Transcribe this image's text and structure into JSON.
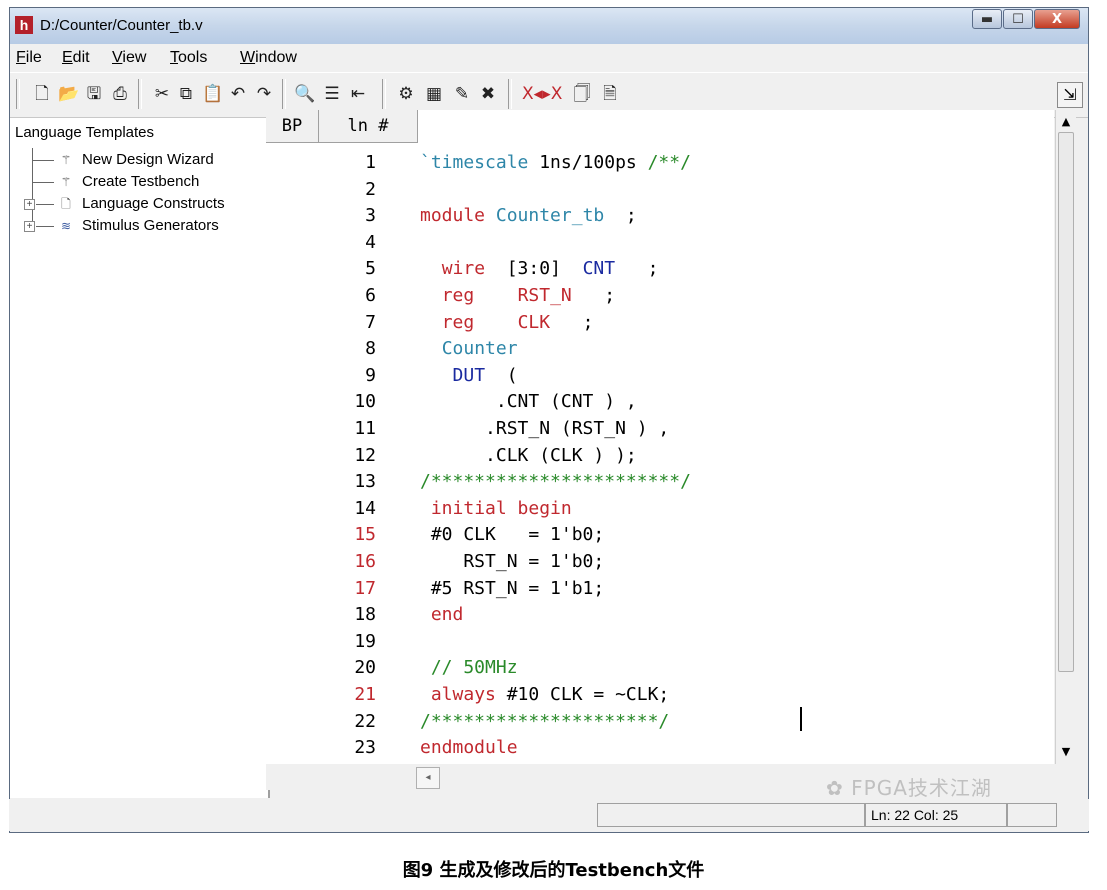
{
  "window": {
    "title": "D:/Counter/Counter_tb.v",
    "app_icon": "h",
    "controls": {
      "minimize": "▬",
      "maximize": "☐",
      "close": "X"
    }
  },
  "menu": [
    "File",
    "Edit",
    "View",
    "Tools",
    "Window"
  ],
  "toolbar_icons": [
    "new-file-icon",
    "open-folder-icon",
    "save-icon",
    "print-icon",
    "cut-icon",
    "copy-icon",
    "paste-icon",
    "undo-icon",
    "redo-icon",
    "find-icon",
    "indent-icon",
    "outdent-icon",
    "compile-icon",
    "simulate-icon",
    "wave-icon",
    "clear-icon",
    "comment-icon",
    "doc-icon",
    "doc2-icon",
    "dock-icon"
  ],
  "left_panel": {
    "title": "Language Templates",
    "items": [
      {
        "label": "New Design Wizard",
        "icon": "wizard-icon"
      },
      {
        "label": "Create Testbench",
        "icon": "wizard-icon"
      },
      {
        "label": "Language Constructs",
        "icon": "doc-icon"
      },
      {
        "label": "Stimulus Generators",
        "icon": "generator-icon"
      }
    ]
  },
  "editor": {
    "header_bp": "BP",
    "header_ln": "ln #",
    "lines": [
      {
        "n": "1",
        "text": "`timescale 1ns/100ps /**/"
      },
      {
        "n": "2",
        "text": ""
      },
      {
        "n": "3",
        "text": "module Counter_tb  ;"
      },
      {
        "n": "4",
        "text": ""
      },
      {
        "n": "5",
        "text": "  wire  [3:0]  CNT   ;"
      },
      {
        "n": "6",
        "text": "  reg    RST_N   ;"
      },
      {
        "n": "7",
        "text": "  reg    CLK   ;"
      },
      {
        "n": "8",
        "text": "  Counter"
      },
      {
        "n": "9",
        "text": "   DUT  ("
      },
      {
        "n": "10",
        "text": "       .CNT (CNT ) ,"
      },
      {
        "n": "11",
        "text": "      .RST_N (RST_N ) ,"
      },
      {
        "n": "12",
        "text": "      .CLK (CLK ) );"
      },
      {
        "n": "13",
        "text": "/***********************/"
      },
      {
        "n": "14",
        "text": " initial begin"
      },
      {
        "n": "15",
        "text": " #0 CLK   = 1'b0;"
      },
      {
        "n": "16",
        "text": "    RST_N = 1'b0;"
      },
      {
        "n": "17",
        "text": " #5 RST_N = 1'b1;"
      },
      {
        "n": "18",
        "text": " end"
      },
      {
        "n": "19",
        "text": ""
      },
      {
        "n": "20",
        "text": " // 50MHz"
      },
      {
        "n": "21",
        "text": " always #10 CLK = ~CLK;"
      },
      {
        "n": "22",
        "text": "/*********************/"
      },
      {
        "n": "23",
        "text": "endmodule"
      }
    ]
  },
  "status": {
    "position": "Ln:  22 Col: 25"
  },
  "watermark": "FPGA技术江湖",
  "caption": "图9 生成及修改后的Testbench文件",
  "colors": {
    "keyword": "#c0282e",
    "identifier": "#2e86a8",
    "comment": "#2a8a2a",
    "type": "#1a2aa0",
    "number": "#000000",
    "lineno_marked": "#c0282e"
  }
}
